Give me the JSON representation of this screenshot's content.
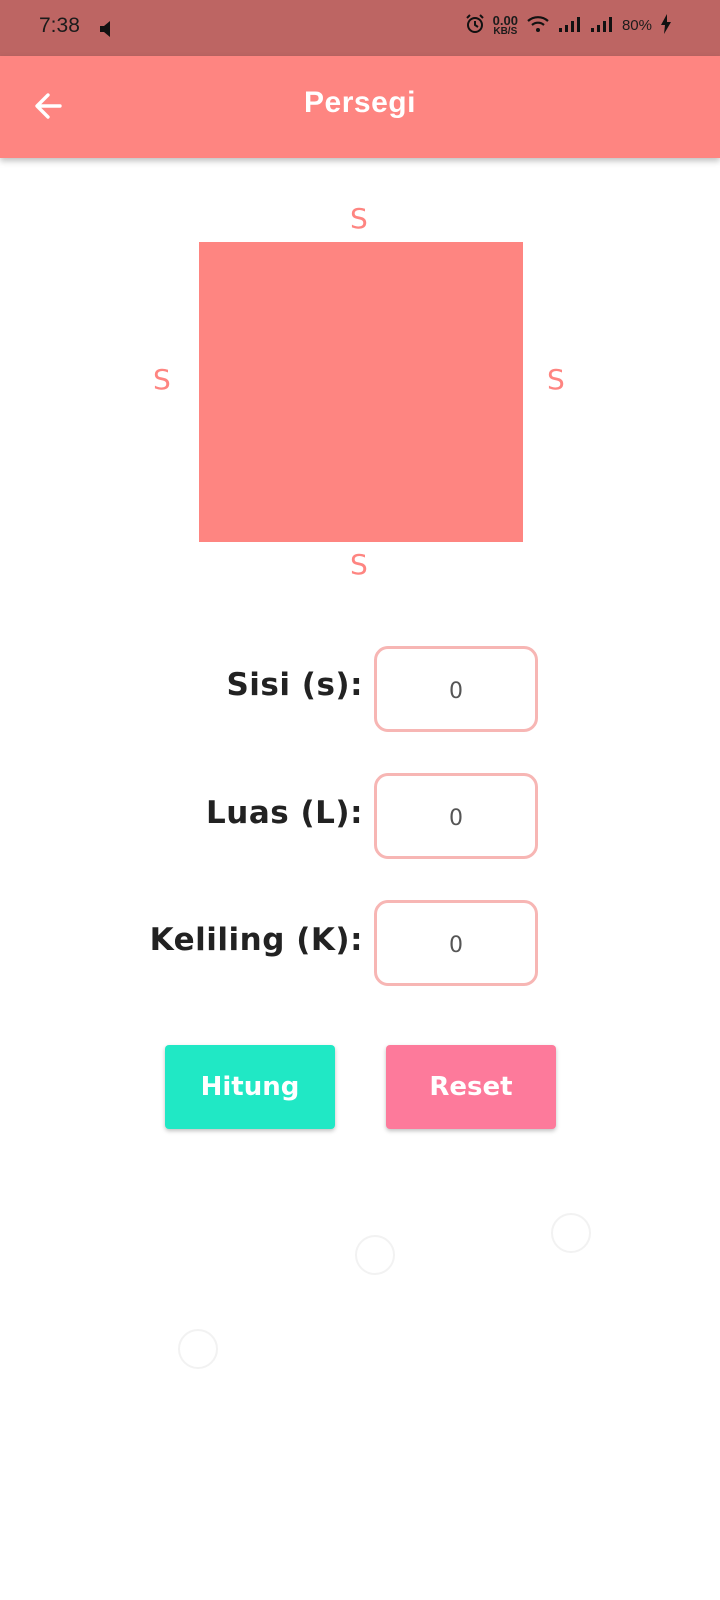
{
  "status_bar": {
    "time": "7:38",
    "net_speed_value": "0.00",
    "net_speed_unit": "KB/S",
    "battery": "80%"
  },
  "app_bar": {
    "title": "Persegi"
  },
  "diagram": {
    "top_label": "S",
    "left_label": "S",
    "right_label": "S",
    "bottom_label": "S",
    "shape_color": "#fe8581"
  },
  "form": {
    "sisi_label": "Sisi (s):",
    "sisi_value": "0",
    "luas_label": "Luas (L):",
    "luas_value": "0",
    "keliling_label": "Keliling (K):",
    "keliling_value": "0"
  },
  "buttons": {
    "hitung": "Hitung",
    "reset": "Reset"
  },
  "colors": {
    "status_bar": "#bd6563",
    "app_bar": "#fe8581",
    "hitung_button": "#20e8c5",
    "reset_button": "#fd7a9b",
    "field_border": "#f7b6b4"
  }
}
